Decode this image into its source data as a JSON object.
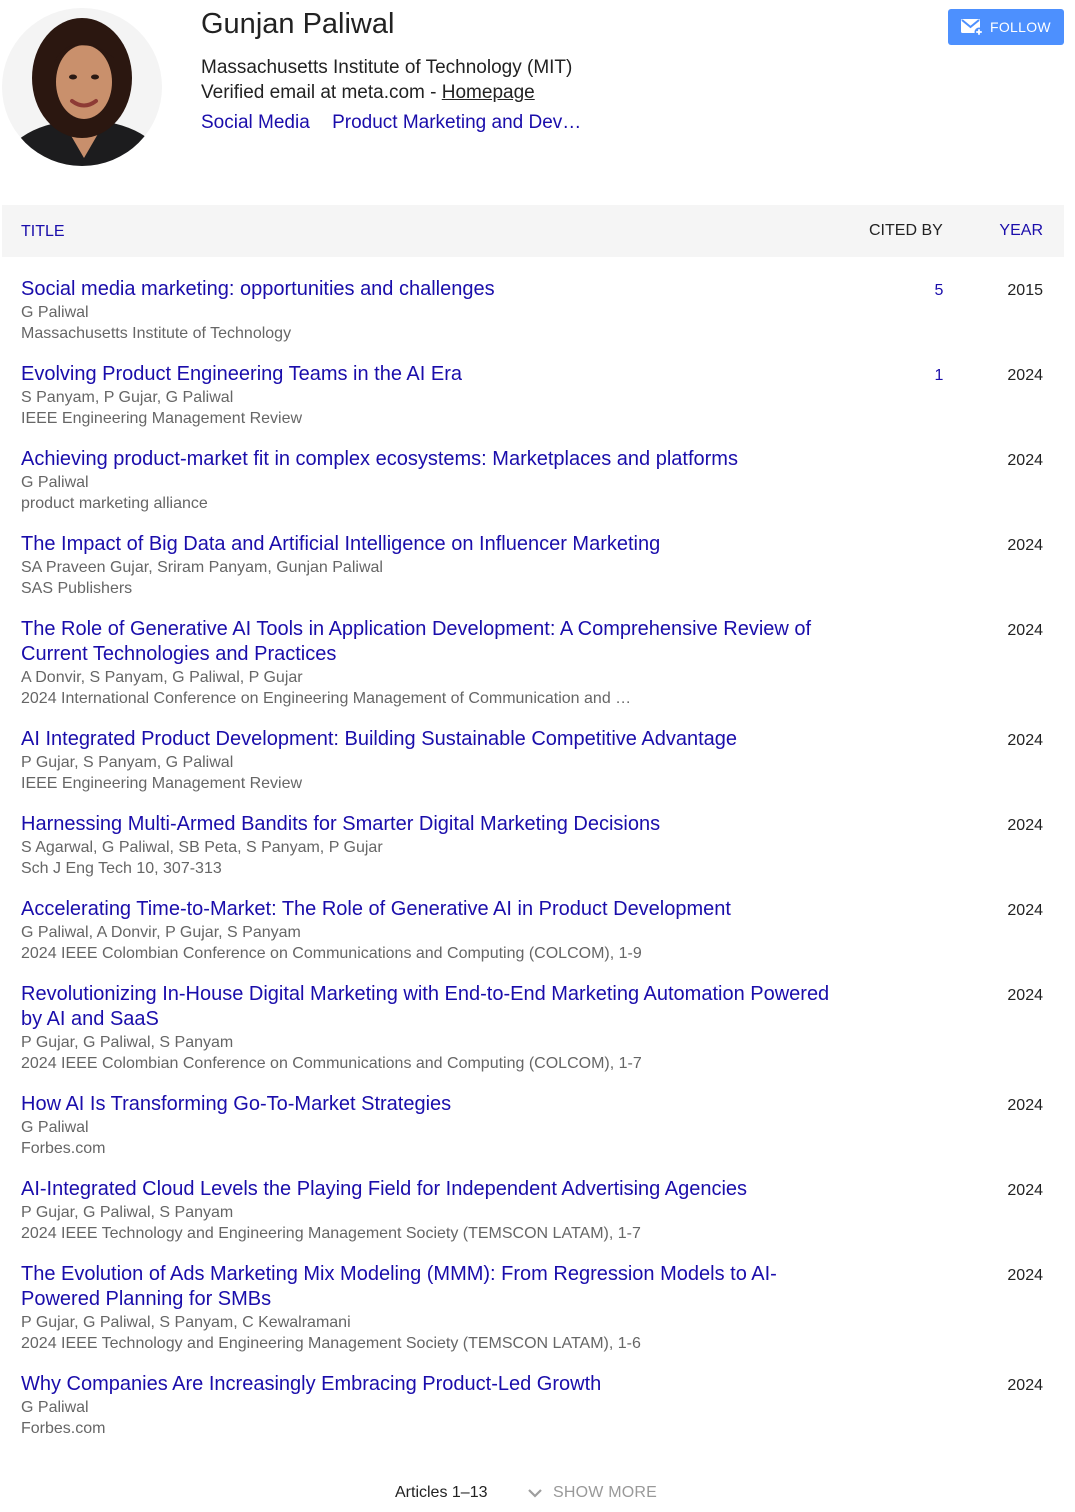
{
  "profile": {
    "name": "Gunjan Paliwal",
    "affiliation": "Massachusetts Institute of Technology (MIT)",
    "email_text": "Verified email at meta.com - ",
    "homepage_label": "Homepage",
    "interests": [
      "Social Media",
      "Product Marketing and Dev…"
    ],
    "follow_label": "FOLLOW",
    "accent_color": "#4d90fe",
    "link_color": "#1a0dab"
  },
  "table": {
    "headers": {
      "title": "TITLE",
      "cited_by": "CITED BY",
      "year": "YEAR"
    },
    "rows": [
      {
        "title": "Social media marketing: opportunities and challenges",
        "authors": "G Paliwal",
        "venue": "Massachusetts Institute of Technology",
        "cited": "5",
        "year": "2015"
      },
      {
        "title": "Evolving Product Engineering Teams in the AI Era",
        "authors": "S Panyam, P Gujar, G Paliwal",
        "venue": "IEEE Engineering Management Review",
        "cited": "1",
        "year": "2024"
      },
      {
        "title": "Achieving product-market fit in complex ecosystems: Marketplaces and platforms",
        "authors": "G Paliwal",
        "venue": "product marketing alliance",
        "cited": "",
        "year": "2024"
      },
      {
        "title": "The Impact of Big Data and Artificial Intelligence on Influencer Marketing",
        "authors": "SA Praveen Gujar, Sriram Panyam, Gunjan Paliwal",
        "venue": "SAS Publishers",
        "cited": "",
        "year": "2024"
      },
      {
        "title": "The Role of Generative AI Tools in Application Development: A Comprehensive Review of Current Technologies and Practices",
        "authors": "A Donvir, S Panyam, G Paliwal, P Gujar",
        "venue": "2024 International Conference on Engineering Management of Communication and …",
        "cited": "",
        "year": "2024"
      },
      {
        "title": "AI Integrated Product Development: Building Sustainable Competitive Advantage",
        "authors": "P Gujar, S Panyam, G Paliwal",
        "venue": "IEEE Engineering Management Review",
        "cited": "",
        "year": "2024"
      },
      {
        "title": "Harnessing Multi-Armed Bandits for Smarter Digital Marketing Decisions",
        "authors": "S Agarwal, G Paliwal, SB Peta, S Panyam, P Gujar",
        "venue": "Sch J Eng Tech 10, 307-313",
        "cited": "",
        "year": "2024"
      },
      {
        "title": "Accelerating Time-to-Market: The Role of Generative AI in Product Development",
        "authors": "G Paliwal, A Donvir, P Gujar, S Panyam",
        "venue": "2024 IEEE Colombian Conference on Communications and Computing (COLCOM), 1-9",
        "cited": "",
        "year": "2024"
      },
      {
        "title": "Revolutionizing In-House Digital Marketing with End-to-End Marketing Automation Powered by AI and SaaS",
        "authors": "P Gujar, G Paliwal, S Panyam",
        "venue": "2024 IEEE Colombian Conference on Communications and Computing (COLCOM), 1-7",
        "cited": "",
        "year": "2024"
      },
      {
        "title": "How AI Is Transforming Go-To-Market Strategies",
        "authors": "G Paliwal",
        "venue": "Forbes.com",
        "cited": "",
        "year": "2024"
      },
      {
        "title": "AI-Integrated Cloud Levels the Playing Field for Independent Advertising Agencies",
        "authors": "P Gujar, G Paliwal, S Panyam",
        "venue": "2024 IEEE Technology and Engineering Management Society (TEMSCON LATAM), 1-7",
        "cited": "",
        "year": "2024"
      },
      {
        "title": "The Evolution of Ads Marketing Mix Modeling (MMM): From Regression Models to AI-Powered Planning for SMBs",
        "authors": "P Gujar, G Paliwal, S Panyam, C Kewalramani",
        "venue": "2024 IEEE Technology and Engineering Management Society (TEMSCON LATAM), 1-6",
        "cited": "",
        "year": "2024"
      },
      {
        "title": "Why Companies Are Increasingly Embracing Product-Led Growth",
        "authors": "G Paliwal",
        "venue": "Forbes.com",
        "cited": "",
        "year": "2024"
      }
    ]
  },
  "footer": {
    "articles_count": "Articles 1–13",
    "show_more_label": "SHOW MORE"
  }
}
